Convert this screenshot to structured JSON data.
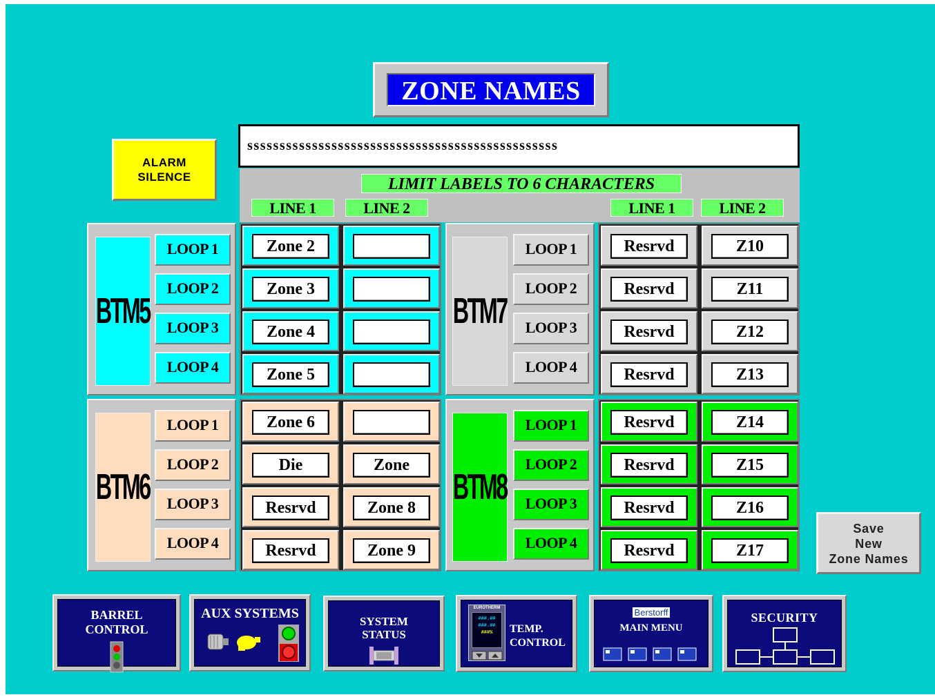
{
  "title": "ZONE NAMES",
  "entry_text": "ssssssssssssssssssssssssssssssssssssssssssssssss",
  "alarm": {
    "line1": "ALARM",
    "line2": "SILENCE"
  },
  "limit_label": "LIMIT LABELS TO 6 CHARACTERS",
  "column_headers": {
    "left_line1": "LINE 1",
    "left_line2": "LINE 2",
    "right_line1": "LINE 1",
    "right_line2": "LINE 2"
  },
  "modules": [
    {
      "name": "BTM5",
      "color": "#00ffff",
      "loops": [
        "LOOP 1",
        "LOOP 2",
        "LOOP 3",
        "LOOP 4"
      ],
      "line1": [
        "Zone 2",
        "Zone 3",
        "Zone 4",
        "Zone 5"
      ],
      "line2": [
        "",
        "",
        "",
        ""
      ]
    },
    {
      "name": "BTM6",
      "color": "#ffdcbe",
      "loops": [
        "LOOP 1",
        "LOOP 2",
        "LOOP 3",
        "LOOP 4"
      ],
      "line1": [
        "Zone 6",
        "Die",
        "Resrvd",
        "Resrvd"
      ],
      "line2": [
        "",
        "Zone",
        "Zone 8",
        "Zone 9"
      ]
    },
    {
      "name": "BTM7",
      "color": "#d8d8d8",
      "loops": [
        "LOOP 1",
        "LOOP 2",
        "LOOP 3",
        "LOOP 4"
      ],
      "line1": [
        "Resrvd",
        "Resrvd",
        "Resrvd",
        "Resrvd"
      ],
      "line2": [
        "Z10",
        "Z11",
        "Z12",
        "Z13"
      ]
    },
    {
      "name": "BTM8",
      "color": "#00ee00",
      "loops": [
        "LOOP 1",
        "LOOP 2",
        "LOOP 3",
        "LOOP 4"
      ],
      "line1": [
        "Resrvd",
        "Resrvd",
        "Resrvd",
        "Resrvd"
      ],
      "line2": [
        "Z14",
        "Z15",
        "Z16",
        "Z17"
      ]
    }
  ],
  "save_button": {
    "line1": "Save",
    "line2": "New",
    "line3": "Zone Names"
  },
  "nav": {
    "barrel": {
      "line1": "BARREL",
      "line2": "CONTROL"
    },
    "aux": {
      "label": "AUX SYSTEMS"
    },
    "system": {
      "line1": "SYSTEM",
      "line2": "STATUS"
    },
    "temp": {
      "line1": "TEMP.",
      "line2": "CONTROL",
      "brand": "EUROTHERM",
      "readouts": [
        "###.##",
        "###.##",
        "###%"
      ]
    },
    "main": {
      "brand": "Berstorff",
      "label": "MAIN MENU"
    },
    "security": {
      "label": "SECURITY"
    }
  }
}
